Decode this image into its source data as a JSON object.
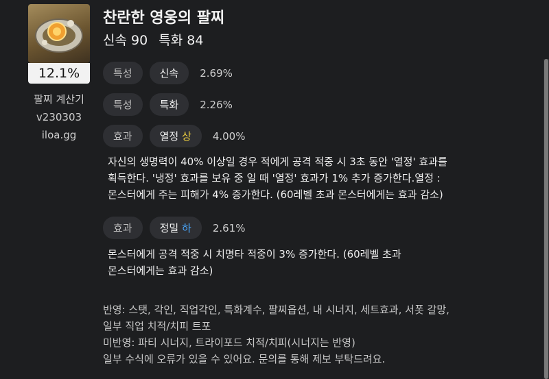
{
  "item": {
    "title": "찬란한 영웅의 팔찌",
    "stats": [
      "신속 90",
      "특화 84"
    ],
    "percent": "12.1%"
  },
  "calculator": {
    "name": "팔찌 계산기",
    "version": "v230303",
    "site": "iloa.gg"
  },
  "effects": [
    {
      "type": "특성",
      "name": "신속",
      "grade": "",
      "value": "2.69%"
    },
    {
      "type": "특성",
      "name": "특화",
      "grade": "",
      "value": "2.26%"
    },
    {
      "type": "효과",
      "name": "열정",
      "grade": "상",
      "value": "4.00%",
      "description": [
        "자신의 생명력이 40% 이상일 경우 적에게 공격 적중 시 3초 동안 '열정' 효과를",
        "획득한다. '냉정' 효과를 보유 중 일 때 '열정' 효과가 1% 추가 증가한다.열정 :",
        "몬스터에게 주는 피해가 4% 증가한다. (60레벨 초과 몬스터에게는 효과 감소)"
      ]
    },
    {
      "type": "효과",
      "name": "정밀",
      "grade": "하",
      "value": "2.61%",
      "description": [
        "몬스터에게 공격 적중 시 치명타 적중이 3% 증가한다. (60레벨 초과",
        "몬스터에게는 효과 감소)"
      ]
    }
  ],
  "footer": [
    "반영: 스탯, 각인, 직업각인, 특화계수, 팔찌옵션, 내 시너지, 세트효과, 서폿 갈망,",
    "일부 직업 치적/치피 트포",
    "미반영: 파티 시너지, 트라이포드 치적/치피(시너지는 반영)",
    "일부 수식에 오류가 있을 수 있어요. 문의를 통해 제보 부탁드려요."
  ],
  "colors": {
    "grade_high": "#f2d340",
    "grade_low": "#4aa8ff",
    "background": "#1d1e20"
  },
  "icons": {
    "item": "bracelet-icon"
  }
}
